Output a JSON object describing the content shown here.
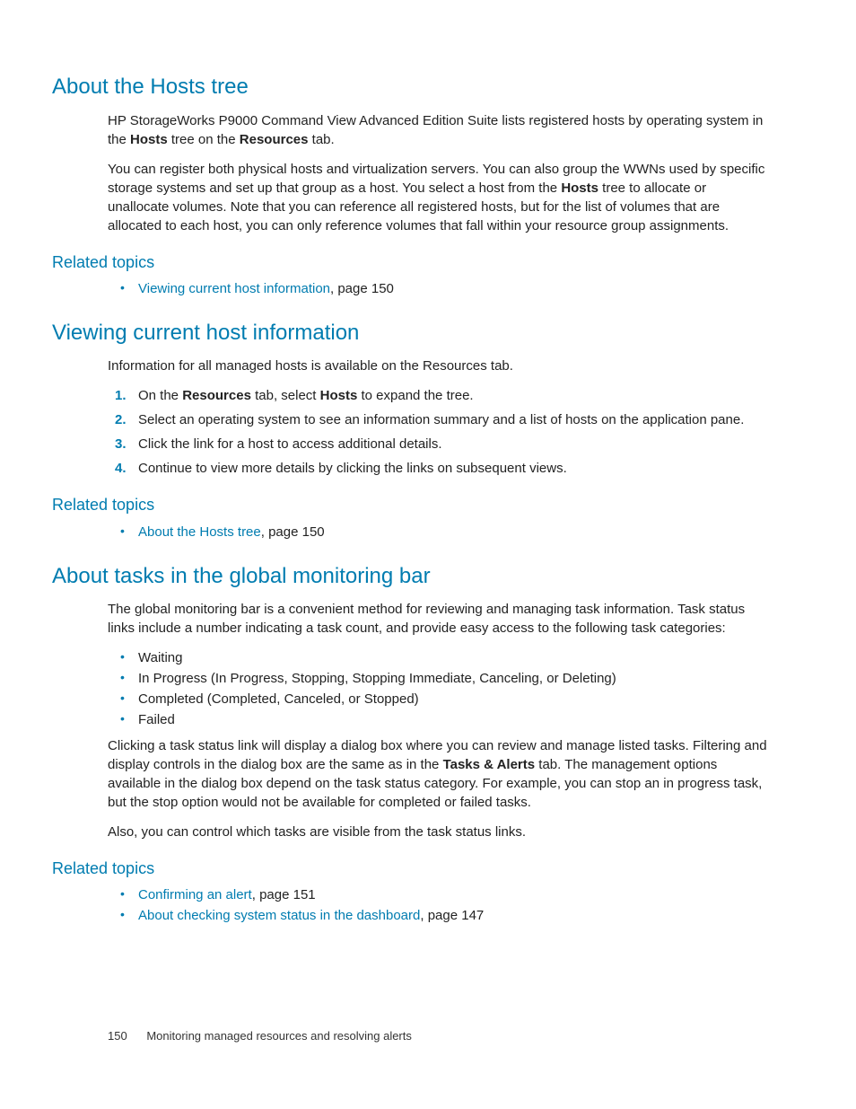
{
  "section1": {
    "title": "About the Hosts tree",
    "para1_a": "HP StorageWorks P9000 Command View Advanced Edition Suite lists registered hosts by operating system in the ",
    "para1_b": "Hosts",
    "para1_c": " tree on the ",
    "para1_d": "Resources",
    "para1_e": " tab.",
    "para2_a": "You can register both physical hosts and virtualization servers. You can also group the WWNs used by specific storage systems and set up that group as a host. You select a host from the ",
    "para2_b": "Hosts",
    "para2_c": " tree to allocate or unallocate volumes. Note that you can reference all registered hosts, but for the list of volumes that are allocated to each host, you can only reference volumes that fall within your resource group assignments.",
    "related_heading": "Related topics",
    "related_link": "Viewing current host information",
    "related_link_suffix": ", page 150"
  },
  "section2": {
    "title": "Viewing current host information",
    "para1": "Information for all managed hosts is available on the Resources tab.",
    "step1_a": "On the ",
    "step1_b": "Resources",
    "step1_c": " tab, select ",
    "step1_d": "Hosts",
    "step1_e": " to expand the tree.",
    "step2": "Select an operating system to see an information summary and a list of hosts on the application pane.",
    "step3": "Click the link for a host to access additional details.",
    "step4": "Continue to view more details by clicking the links on subsequent views.",
    "related_heading": "Related topics",
    "related_link": "About the Hosts tree",
    "related_link_suffix": ", page 150"
  },
  "section3": {
    "title": "About tasks in the global monitoring bar",
    "para1": "The global monitoring bar is a convenient method for reviewing and managing task information. Task status links include a number indicating a task count, and provide easy access to the following task categories:",
    "bullets": [
      "Waiting",
      "In Progress (In Progress, Stopping, Stopping Immediate, Canceling, or Deleting)",
      "Completed (Completed, Canceled, or Stopped)",
      "Failed"
    ],
    "para2_a": "Clicking a task status link will display a dialog box where you can review and manage listed tasks. Filtering and display controls in the dialog box are the same as in the ",
    "para2_b": "Tasks & Alerts",
    "para2_c": " tab. The management options available in the dialog box depend on the task status category. For example, you can stop an in progress task, but the stop option would not be available for completed or failed tasks.",
    "para3": "Also, you can control which tasks are visible from the task status links.",
    "related_heading": "Related topics",
    "related_link1": "Confirming an alert",
    "related_link1_suffix": ", page 151",
    "related_link2": "About checking system status in the dashboard",
    "related_link2_suffix": ", page 147"
  },
  "footer": {
    "page_number": "150",
    "chapter": "Monitoring managed resources and resolving alerts"
  }
}
